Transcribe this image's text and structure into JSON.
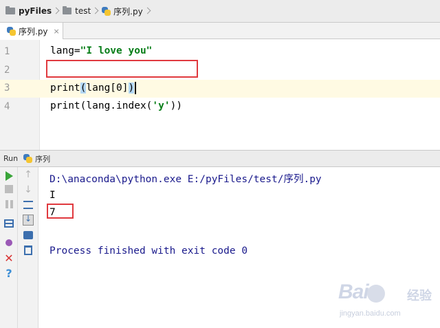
{
  "breadcrumb": {
    "project": "pyFiles",
    "folder": "test",
    "file": "序列.py"
  },
  "tabs": [
    {
      "label": "序列.py",
      "close": "×"
    }
  ],
  "editor": {
    "line_numbers": [
      "1",
      "2",
      "3",
      "4"
    ],
    "lines": {
      "l1_prefix": "lang=",
      "l1_string": "\"I love you\"",
      "l3_prefix": "print",
      "l3_open": "(",
      "l3_inner": "lang[0]",
      "l3_close": ")",
      "l4_prefix": "print(lang.index(",
      "l4_string": "'y'",
      "l4_suffix": "))"
    }
  },
  "run": {
    "title": "Run",
    "config": "序列",
    "output": {
      "command": "D:\\anaconda\\python.exe E:/pyFiles/test/序列.py",
      "line1": "I",
      "line2": "7",
      "process": "Process finished with exit code 0"
    }
  },
  "watermark": {
    "logo": "Bai",
    "cn": "经验",
    "url": "jingyan.baidu.com"
  },
  "colors": {
    "highlight_box": "#e0393e",
    "string": "#067d17",
    "console_info": "#1a1a8c",
    "run_green": "#3aa53a"
  }
}
